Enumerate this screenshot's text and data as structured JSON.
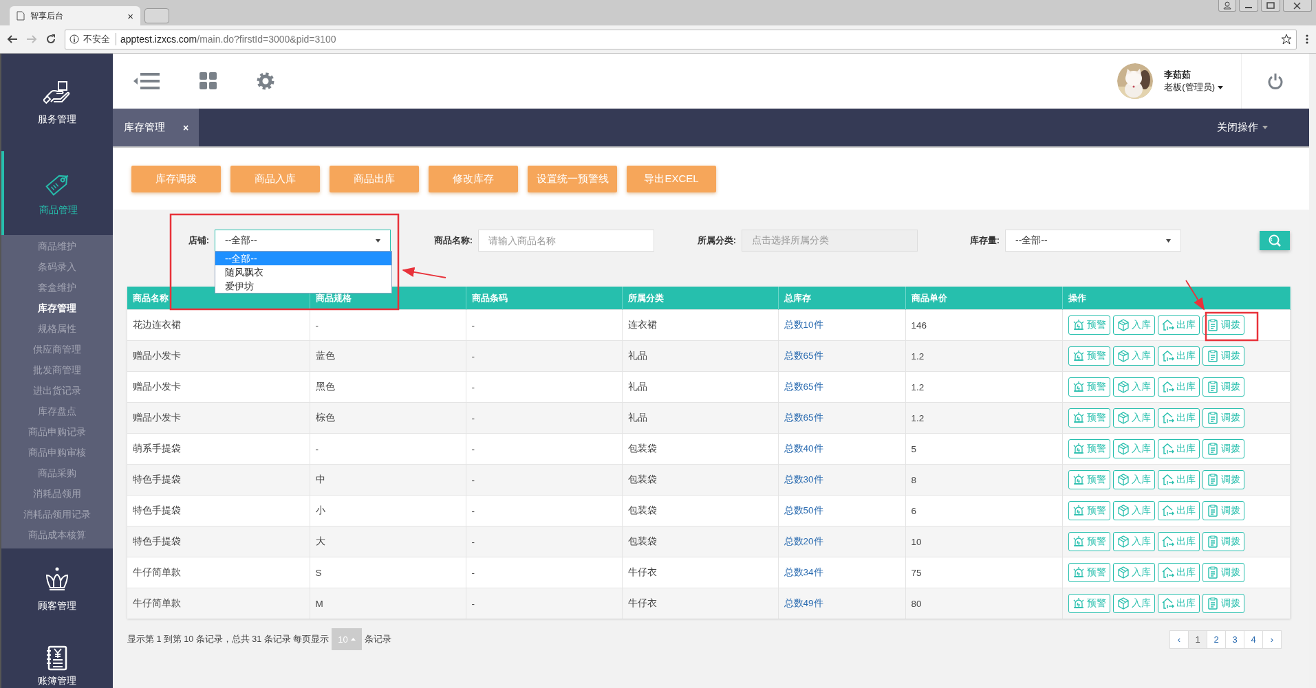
{
  "browser": {
    "tab_title": "智享后台",
    "tab_close": "×",
    "security": "不安全",
    "url_host": "apptest.izxcs.com",
    "url_path": "/main.do?firstId=3000&pid=3100"
  },
  "sidebar": {
    "sections": [
      {
        "kind": "service",
        "label": "服务管理",
        "selected": false
      },
      {
        "kind": "sale",
        "label": "商品管理",
        "selected": true,
        "expanded": true,
        "children": [
          {
            "label": "商品维护",
            "selected": false
          },
          {
            "label": "条码录入",
            "selected": false
          },
          {
            "label": "套盒维护",
            "selected": false
          },
          {
            "label": "库存管理",
            "selected": true
          },
          {
            "label": "规格属性",
            "selected": false
          },
          {
            "label": "供应商管理",
            "selected": false
          },
          {
            "label": "批发商管理",
            "selected": false
          },
          {
            "label": "进出货记录",
            "selected": false
          },
          {
            "label": "库存盘点",
            "selected": false
          },
          {
            "label": "商品申购记录",
            "selected": false
          },
          {
            "label": "商品申购审核",
            "selected": false
          },
          {
            "label": "商品采购",
            "selected": false
          },
          {
            "label": "消耗品领用",
            "selected": false
          },
          {
            "label": "消耗品领用记录",
            "selected": false
          },
          {
            "label": "商品成本核算",
            "selected": false
          }
        ]
      },
      {
        "kind": "customer",
        "label": "顾客管理",
        "selected": false
      },
      {
        "kind": "ledger",
        "label": "账簿管理",
        "selected": false
      }
    ]
  },
  "user": {
    "name": "李茹茹",
    "role": "老板(管理员)"
  },
  "tabs": [
    {
      "label": "库存管理",
      "selected": true,
      "close": "×"
    }
  ],
  "close_menu": "关闭操作",
  "actions": [
    "库存调拨",
    "商品入库",
    "商品出库",
    "修改库存",
    "设置统一预警线",
    "导出EXCEL"
  ],
  "filters": [
    {
      "kind": "select",
      "label": "店铺:",
      "value": "--全部--",
      "open": true,
      "options": [
        {
          "label": "--全部--",
          "selected": true
        },
        {
          "label": "随风飘衣",
          "selected": false
        },
        {
          "label": "爱伊坊",
          "selected": false
        }
      ]
    },
    {
      "kind": "input",
      "label": "商品名称:",
      "placeholder": "请输入商品名称"
    },
    {
      "kind": "picker",
      "label": "所属分类:",
      "placeholder": "点击选择所属分类"
    },
    {
      "kind": "select",
      "label": "库存量:",
      "value": "--全部--",
      "open": false
    }
  ],
  "table": {
    "columns": [
      "商品名称",
      "商品规格",
      "商品条码",
      "所属分类",
      "总库存",
      "商品单价",
      "操作"
    ],
    "rows": [
      {
        "cells": [
          "花边连衣裙",
          "-",
          "-",
          "连衣裙",
          "总数10件",
          "146"
        ],
        "actions": [
          {
            "kind": "alarm",
            "label": "预警"
          },
          {
            "kind": "in",
            "label": "入库"
          },
          {
            "kind": "out",
            "label": "出库"
          },
          {
            "kind": "transfer",
            "label": "调拨"
          }
        ]
      },
      {
        "cells": [
          "赠品小发卡",
          "蓝色",
          "-",
          "礼品",
          "总数65件",
          "1.2"
        ],
        "actions": [
          {
            "kind": "alarm",
            "label": "预警"
          },
          {
            "kind": "in",
            "label": "入库"
          },
          {
            "kind": "out",
            "label": "出库"
          },
          {
            "kind": "transfer",
            "label": "调拨"
          }
        ]
      },
      {
        "cells": [
          "赠品小发卡",
          "黑色",
          "-",
          "礼品",
          "总数65件",
          "1.2"
        ],
        "actions": [
          {
            "kind": "alarm",
            "label": "预警"
          },
          {
            "kind": "in",
            "label": "入库"
          },
          {
            "kind": "out",
            "label": "出库"
          },
          {
            "kind": "transfer",
            "label": "调拨"
          }
        ]
      },
      {
        "cells": [
          "赠品小发卡",
          "棕色",
          "-",
          "礼品",
          "总数65件",
          "1.2"
        ],
        "actions": [
          {
            "kind": "alarm",
            "label": "预警"
          },
          {
            "kind": "in",
            "label": "入库"
          },
          {
            "kind": "out",
            "label": "出库"
          },
          {
            "kind": "transfer",
            "label": "调拨"
          }
        ]
      },
      {
        "cells": [
          "萌系手提袋",
          "-",
          "-",
          "包装袋",
          "总数40件",
          "5"
        ],
        "actions": [
          {
            "kind": "alarm",
            "label": "预警"
          },
          {
            "kind": "in",
            "label": "入库"
          },
          {
            "kind": "out",
            "label": "出库"
          },
          {
            "kind": "transfer",
            "label": "调拨"
          }
        ]
      },
      {
        "cells": [
          "特色手提袋",
          "中",
          "-",
          "包装袋",
          "总数30件",
          "8"
        ],
        "actions": [
          {
            "kind": "alarm",
            "label": "预警"
          },
          {
            "kind": "in",
            "label": "入库"
          },
          {
            "kind": "out",
            "label": "出库"
          },
          {
            "kind": "transfer",
            "label": "调拨"
          }
        ]
      },
      {
        "cells": [
          "特色手提袋",
          "小",
          "-",
          "包装袋",
          "总数50件",
          "6"
        ],
        "actions": [
          {
            "kind": "alarm",
            "label": "预警"
          },
          {
            "kind": "in",
            "label": "入库"
          },
          {
            "kind": "out",
            "label": "出库"
          },
          {
            "kind": "transfer",
            "label": "调拨"
          }
        ]
      },
      {
        "cells": [
          "特色手提袋",
          "大",
          "-",
          "包装袋",
          "总数20件",
          "10"
        ],
        "actions": [
          {
            "kind": "alarm",
            "label": "预警"
          },
          {
            "kind": "in",
            "label": "入库"
          },
          {
            "kind": "out",
            "label": "出库"
          },
          {
            "kind": "transfer",
            "label": "调拨"
          }
        ]
      },
      {
        "cells": [
          "牛仔简单款",
          "S",
          "-",
          "牛仔衣",
          "总数34件",
          "75"
        ],
        "actions": [
          {
            "kind": "alarm",
            "label": "预警"
          },
          {
            "kind": "in",
            "label": "入库"
          },
          {
            "kind": "out",
            "label": "出库"
          },
          {
            "kind": "transfer",
            "label": "调拨"
          }
        ]
      },
      {
        "cells": [
          "牛仔简单款",
          "M",
          "-",
          "牛仔衣",
          "总数49件",
          "80"
        ],
        "actions": [
          {
            "kind": "alarm",
            "label": "预警"
          },
          {
            "kind": "in",
            "label": "入库"
          },
          {
            "kind": "out",
            "label": "出库"
          },
          {
            "kind": "transfer",
            "label": "调拨"
          }
        ]
      }
    ]
  },
  "pager": {
    "summary": "显示第 1 到第 10 条记录，总共 31 条记录 每页显示",
    "page_size": "10",
    "summary_end": "条记录",
    "pages": [
      {
        "label": "‹",
        "selected": false
      },
      {
        "label": "1",
        "selected": true
      },
      {
        "label": "2",
        "selected": false
      },
      {
        "label": "3",
        "selected": false
      },
      {
        "label": "4",
        "selected": false
      },
      {
        "label": "›",
        "selected": false
      }
    ]
  }
}
